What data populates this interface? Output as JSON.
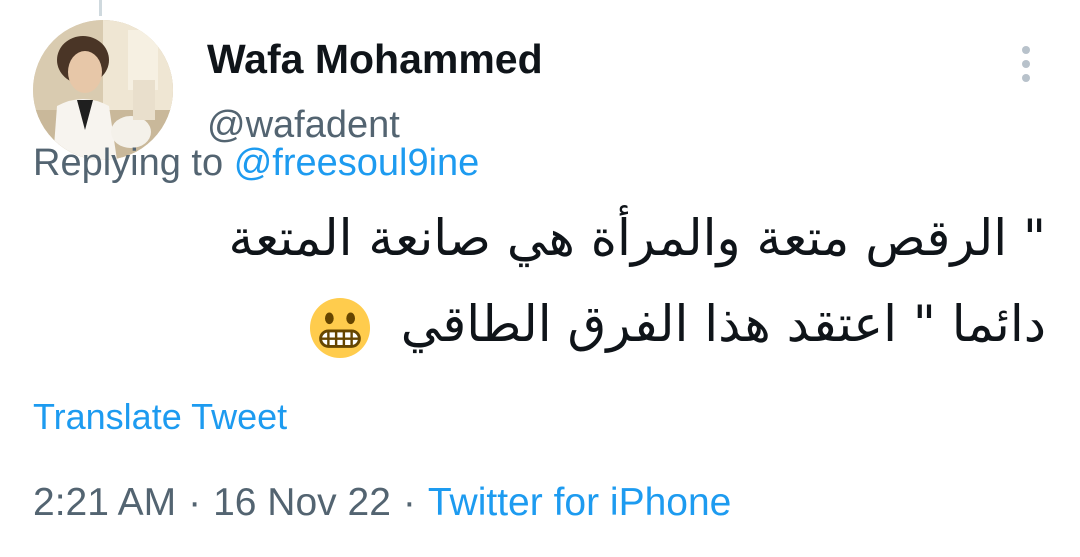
{
  "tweet": {
    "author": {
      "display_name": "Wafa Mohammed",
      "handle": "@wafadent"
    },
    "reply": {
      "prefix": "Replying to",
      "mention": "@freesoul9ine"
    },
    "text_lines": [
      "\" الرقص متعة والمرأة هي صانعة المتعة",
      "دائما   \" اعتقد هذا الفرق الطاقي"
    ],
    "emoji": "grimacing-face-emoji",
    "translate_label": "Translate Tweet",
    "meta": {
      "time": "2:21 AM",
      "separator": "·",
      "date": "16 Nov 22",
      "source": "Twitter for iPhone"
    }
  },
  "icons": {
    "more": "more-vertical-icon"
  },
  "colors": {
    "text_primary": "#0f1419",
    "text_secondary": "#536471",
    "link": "#1d9bf0",
    "emoji": "#ffcc4d"
  }
}
